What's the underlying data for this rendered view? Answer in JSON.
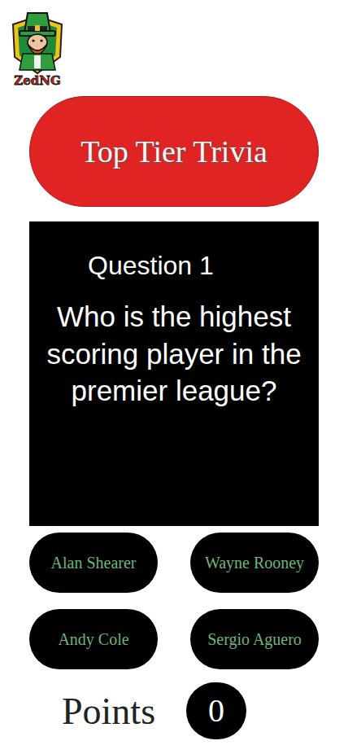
{
  "logo": {
    "text": "ZedNG"
  },
  "title": "Top Tier Trivia",
  "question": {
    "number": "Question 1",
    "text": "Who is the highest scoring player in the premier league?"
  },
  "answers": [
    {
      "label": "Alan Shearer"
    },
    {
      "label": "Wayne Rooney"
    },
    {
      "label": "Andy Cole"
    },
    {
      "label": "Sergio Aguero"
    }
  ],
  "score": {
    "label": "Points",
    "value": "0"
  }
}
